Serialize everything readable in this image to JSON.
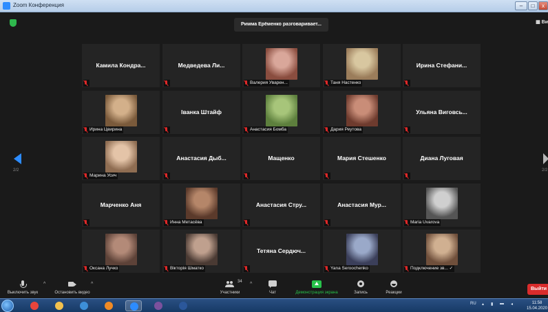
{
  "window": {
    "title": "Zoom Конференция",
    "buttons": [
      "–",
      "□",
      "x"
    ]
  },
  "meeting": {
    "speaker_banner": "Римма Ерёменко разговаривает...",
    "view_toggle": "Ви",
    "page_left": "2/2",
    "page_right": "2/2"
  },
  "participants": [
    {
      "name": "Камила Кондра...",
      "video": false
    },
    {
      "name": "Медведева Ли...",
      "video": false
    },
    {
      "name": "Валерия Уварен...",
      "video": true,
      "tone": [
        "#d9a79a",
        "#8a4d3f"
      ]
    },
    {
      "name": "Таня Настенко",
      "video": true,
      "tone": [
        "#d8c7a0",
        "#9b7d5b"
      ]
    },
    {
      "name": "Ирина Стефани...",
      "video": false
    },
    {
      "name": "Ирина Цвирина",
      "video": true,
      "tone": [
        "#d3b08a",
        "#7a5a3b"
      ]
    },
    {
      "name": "Іванка Штайф",
      "video": false
    },
    {
      "name": "Анастасия Бомба",
      "video": true,
      "tone": [
        "#a7c57a",
        "#5d7f3d"
      ]
    },
    {
      "name": "Дария Реутова",
      "video": true,
      "tone": [
        "#c98d78",
        "#6e3b2e"
      ]
    },
    {
      "name": "Ульяна Виговсь...",
      "video": false
    },
    {
      "name": "Марина Усич",
      "video": true,
      "tone": [
        "#e4c4a8",
        "#8f6d52"
      ]
    },
    {
      "name": "Анастасия Дыб...",
      "video": false
    },
    {
      "name": "Мащенко",
      "video": false
    },
    {
      "name": "Мария Стешенко",
      "video": false
    },
    {
      "name": "Диана Луговая",
      "video": false
    },
    {
      "name": "Марченко Аня",
      "video": false
    },
    {
      "name": "Инна Метасёва",
      "video": true,
      "tone": [
        "#b58669",
        "#5b3a2b"
      ]
    },
    {
      "name": "Анастасия Стру...",
      "video": false
    },
    {
      "name": "Анастасия Мур...",
      "video": false
    },
    {
      "name": "Maria Uvarova",
      "video": true,
      "tone": [
        "#cfcfcf",
        "#555555"
      ]
    },
    {
      "name": "Оксана Лучко",
      "video": true,
      "tone": [
        "#b38a78",
        "#5d4238"
      ]
    },
    {
      "name": "Вікторія Шматко",
      "video": true,
      "tone": [
        "#bfa08e",
        "#4a3a33"
      ]
    },
    {
      "name": "Тетяна Сердюч...",
      "video": false
    },
    {
      "name": "Yana Seroochenko",
      "video": true,
      "tone": [
        "#9aa9c9",
        "#3b3f5a"
      ]
    },
    {
      "name": "Подключение зв... ✓",
      "video": true,
      "tone": [
        "#d0b091",
        "#6f4f3b"
      ]
    }
  ],
  "controls": {
    "mute": "Выключить звук",
    "stop_video": "Остановить видео",
    "participants": "Участники",
    "participants_count": "34",
    "chat": "Чат",
    "share_screen": "Демонстрация экрана",
    "record": "Запись",
    "reactions": "Реакции",
    "leave": "Выйти"
  },
  "taskbar": {
    "lang": "RU",
    "time": "11:58",
    "date": "15.04.2020",
    "apps": [
      {
        "name": "chrome",
        "color": "#e8453c"
      },
      {
        "name": "explorer",
        "color": "#f2c14e"
      },
      {
        "name": "ie",
        "color": "#3d8fd8"
      },
      {
        "name": "media",
        "color": "#f08a24"
      },
      {
        "name": "zoom",
        "color": "#2d8cff"
      },
      {
        "name": "viber",
        "color": "#7b519d"
      },
      {
        "name": "word",
        "color": "#2b579a"
      }
    ]
  }
}
